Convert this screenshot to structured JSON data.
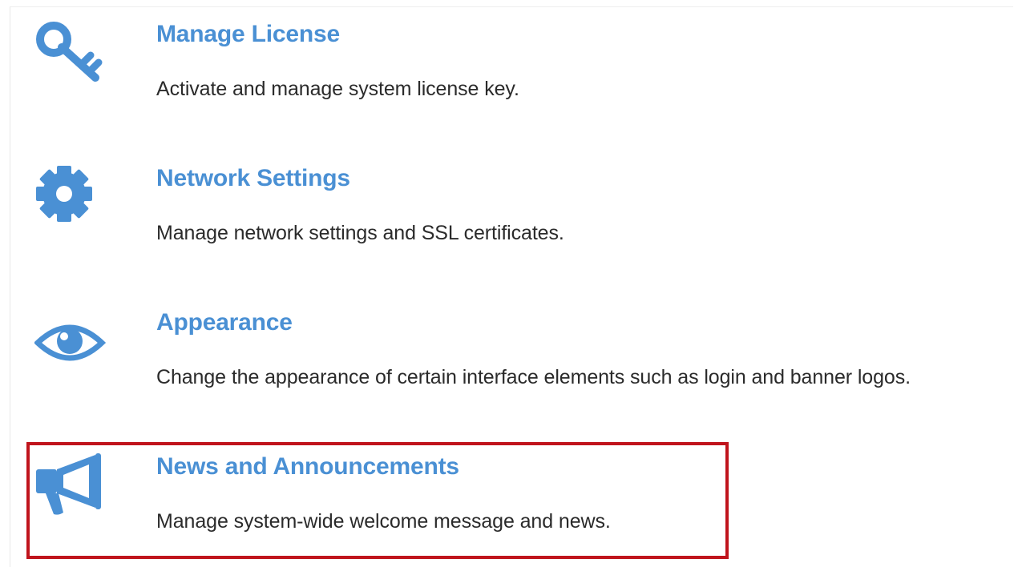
{
  "items": [
    {
      "icon": "key-icon",
      "title": "Manage License",
      "description": "Activate and manage system license key."
    },
    {
      "icon": "gear-icon",
      "title": "Network Settings",
      "description": "Manage network settings and SSL certificates."
    },
    {
      "icon": "eye-icon",
      "title": "Appearance",
      "description": "Change the appearance of certain interface elements such as login and banner logos."
    },
    {
      "icon": "megaphone-icon",
      "title": "News and Announcements",
      "description": "Manage system-wide welcome message and news."
    }
  ],
  "colors": {
    "accent": "#4a90d4",
    "text": "#2b2b2b",
    "highlight": "#c0141c"
  }
}
